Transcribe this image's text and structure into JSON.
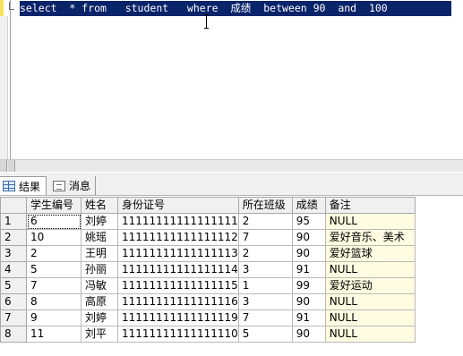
{
  "editor": {
    "sql": "select  * from   student   where  成绩  between 90  and  100"
  },
  "tabs": [
    {
      "label": "结果",
      "icon": "grid-icon"
    },
    {
      "label": "消息",
      "icon": "message-icon"
    }
  ],
  "grid": {
    "columns": [
      "学生编号",
      "姓名",
      "身份证号",
      "所在班级",
      "成绩",
      "备注"
    ],
    "rows": [
      {
        "num": "1",
        "cells": [
          "6",
          "刘婷",
          "11111111111111111",
          "2",
          "95",
          "NULL"
        ]
      },
      {
        "num": "2",
        "cells": [
          "10",
          "姚瑶",
          "11111111111111112",
          "7",
          "90",
          "爱好音乐、美术"
        ]
      },
      {
        "num": "3",
        "cells": [
          "2",
          "王明",
          "11111111111111113",
          "2",
          "90",
          "爱好篮球"
        ]
      },
      {
        "num": "4",
        "cells": [
          "5",
          "孙丽",
          "11111111111111114",
          "3",
          "91",
          "NULL"
        ]
      },
      {
        "num": "5",
        "cells": [
          "7",
          "冯敏",
          "11111111111111115",
          "1",
          "99",
          "爱好运动"
        ]
      },
      {
        "num": "6",
        "cells": [
          "8",
          "高原",
          "11111111111111116",
          "3",
          "90",
          "NULL"
        ]
      },
      {
        "num": "7",
        "cells": [
          "9",
          "刘婷",
          "11111111111111119",
          "7",
          "91",
          "NULL"
        ]
      },
      {
        "num": "8",
        "cells": [
          "11",
          "刘平",
          "11111111111111110",
          "5",
          "90",
          "NULL"
        ]
      }
    ]
  },
  "colors": {
    "selection": "#0a246a",
    "note_bg": "#fffbe0",
    "header_bg": "#f0f0f0"
  }
}
